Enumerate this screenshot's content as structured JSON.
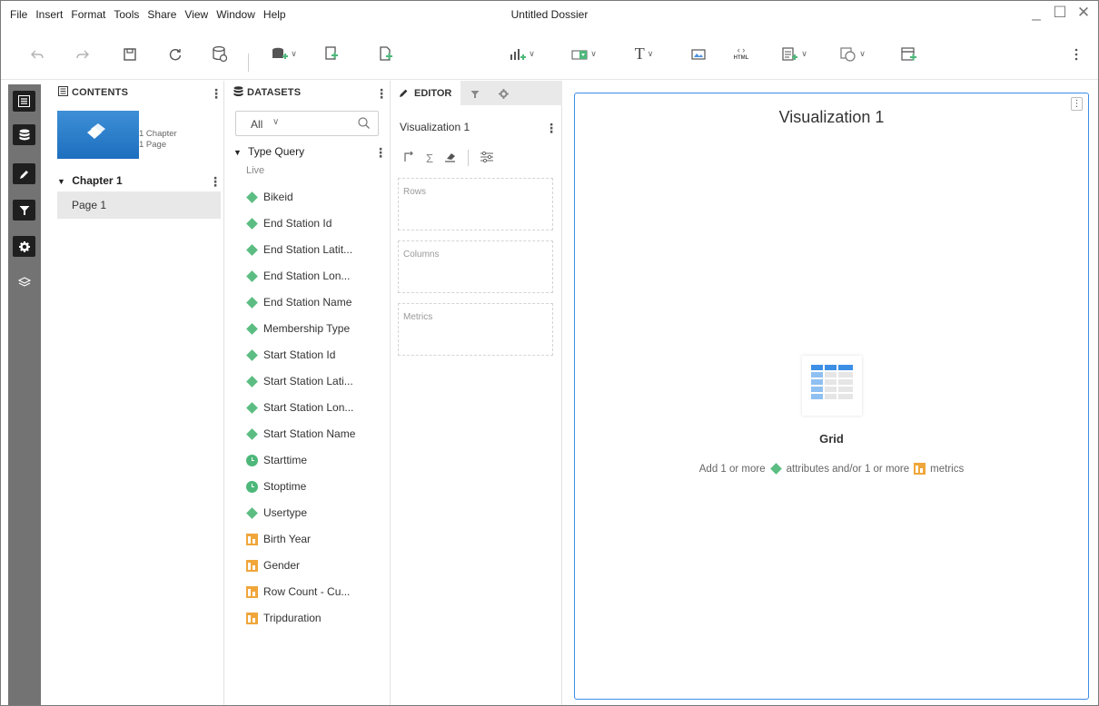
{
  "menu": [
    "File",
    "Insert",
    "Format",
    "Tools",
    "Share",
    "View",
    "Window",
    "Help"
  ],
  "window": {
    "title": "Untitled Dossier",
    "minimize": "_",
    "maximize": "☐",
    "close": "✕"
  },
  "colors": {
    "accent": "#3b8ee8",
    "attribute": "#5cbd82",
    "metric": "#f0a63a",
    "rail": "#737373",
    "thumbnail": "#2a7ccb"
  },
  "toolbar": {
    "items": [
      "undo-icon",
      "redo-icon",
      "save-icon",
      "refresh-icon",
      "data-source-icon",
      "add-data-icon",
      "duplicate-icon",
      "new-page-icon",
      "insert-visualization-icon",
      "insert-filter-icon",
      "text-icon",
      "image-icon",
      "html-icon",
      "insert-panel-icon",
      "shape-icon",
      "new-container-icon",
      "more-icon"
    ],
    "html_label": "HTML",
    "text_glyph": "T"
  },
  "contents": {
    "header": "CONTENTS",
    "chapter_count": "1 Chapter",
    "page_count": "1 Page",
    "chapter_name": "Chapter 1",
    "page_name": "Page 1"
  },
  "datasets": {
    "header": "DATASETS",
    "filter_value": "All",
    "dataset_name": "Type Query",
    "mode": "Live",
    "items": [
      {
        "label": "Bikeid",
        "type": "attribute"
      },
      {
        "label": "End Station Id",
        "type": "attribute"
      },
      {
        "label": "End Station Latit...",
        "type": "attribute"
      },
      {
        "label": "End Station Lon...",
        "type": "attribute"
      },
      {
        "label": "End Station Name",
        "type": "attribute"
      },
      {
        "label": "Membership Type",
        "type": "attribute"
      },
      {
        "label": "Start Station Id",
        "type": "attribute"
      },
      {
        "label": "Start Station Lati...",
        "type": "attribute"
      },
      {
        "label": "Start Station Lon...",
        "type": "attribute"
      },
      {
        "label": "Start Station Name",
        "type": "attribute"
      },
      {
        "label": "Starttime",
        "type": "time"
      },
      {
        "label": "Stoptime",
        "type": "time"
      },
      {
        "label": "Usertype",
        "type": "attribute"
      },
      {
        "label": "Birth Year",
        "type": "metric"
      },
      {
        "label": "Gender",
        "type": "metric"
      },
      {
        "label": "Row Count - Cu...",
        "type": "metric"
      },
      {
        "label": "Tripduration",
        "type": "metric"
      }
    ]
  },
  "editor": {
    "tab_editor": "EDITOR",
    "viz_name": "Visualization 1",
    "sigma": "Σ",
    "zones": [
      "Rows",
      "Columns",
      "Metrics"
    ]
  },
  "canvas": {
    "title": "Visualization 1",
    "grid_label": "Grid",
    "hint_prefix": "Add 1 or more",
    "hint_attributes": "attributes and/or 1 or more",
    "hint_metrics": "metrics"
  }
}
